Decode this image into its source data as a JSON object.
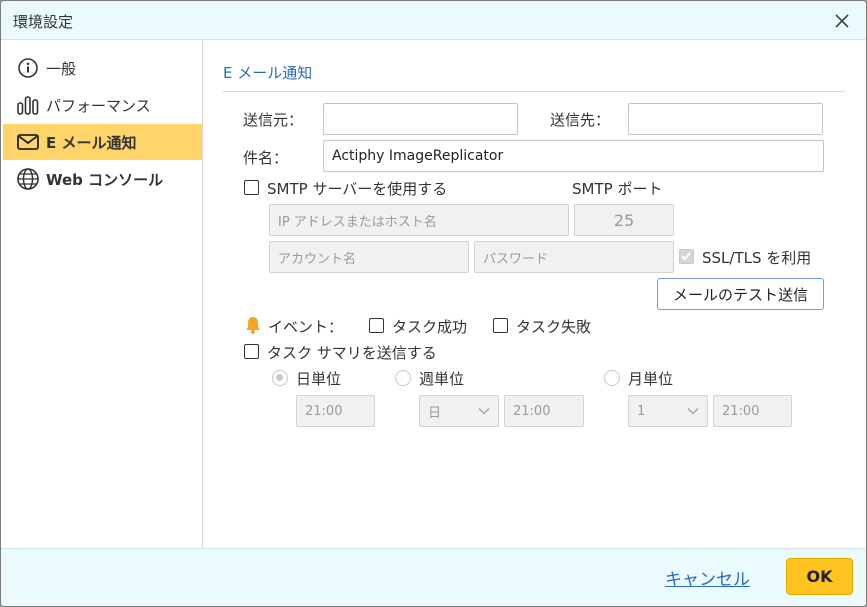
{
  "window": {
    "title": "環境設定"
  },
  "sidebar": {
    "items": [
      {
        "label": "一般",
        "icon": "info-icon"
      },
      {
        "label": "パフォーマンス",
        "icon": "bar-chart-icon"
      },
      {
        "label": "E メール通知",
        "icon": "mail-icon",
        "active": true
      },
      {
        "label": "Web コンソール",
        "icon": "globe-icon"
      }
    ]
  },
  "email": {
    "section_title": "E メール通知",
    "from_label": "送信元：",
    "from_value": "",
    "to_label": "送信先：",
    "to_value": "",
    "subject_label": "件名：",
    "subject_value": "Actiphy ImageReplicator",
    "smtp_checkbox_label": "SMTP サーバーを使用する",
    "smtp_port_label": "SMTP ポート",
    "smtp_host_placeholder": "IP アドレスまたはホスト名",
    "smtp_port_value": "25",
    "account_placeholder": "アカウント名",
    "password_placeholder": "パスワード",
    "ssl_label": "SSL/TLS を利用",
    "ssl_checked": true,
    "test_button": "メールのテスト送信",
    "event_label": "イベント：",
    "task_success_label": "タスク成功",
    "task_failure_label": "タスク失敗",
    "summary_checkbox_label": "タスク サマリを送信する",
    "daily_label": "日単位",
    "weekly_label": "週単位",
    "monthly_label": "月単位",
    "daily_time": "21:00",
    "weekly_day": "日",
    "weekly_time": "21:00",
    "monthly_day": "1",
    "monthly_time": "21:00"
  },
  "footer": {
    "cancel_label": "キャンセル",
    "ok_label": "OK"
  },
  "colors": {
    "accent": "#ffc31f",
    "active_nav": "#ffd56a",
    "link": "#2a6ac2",
    "header_bg": "#eafafd",
    "bell": "#f5a623"
  }
}
